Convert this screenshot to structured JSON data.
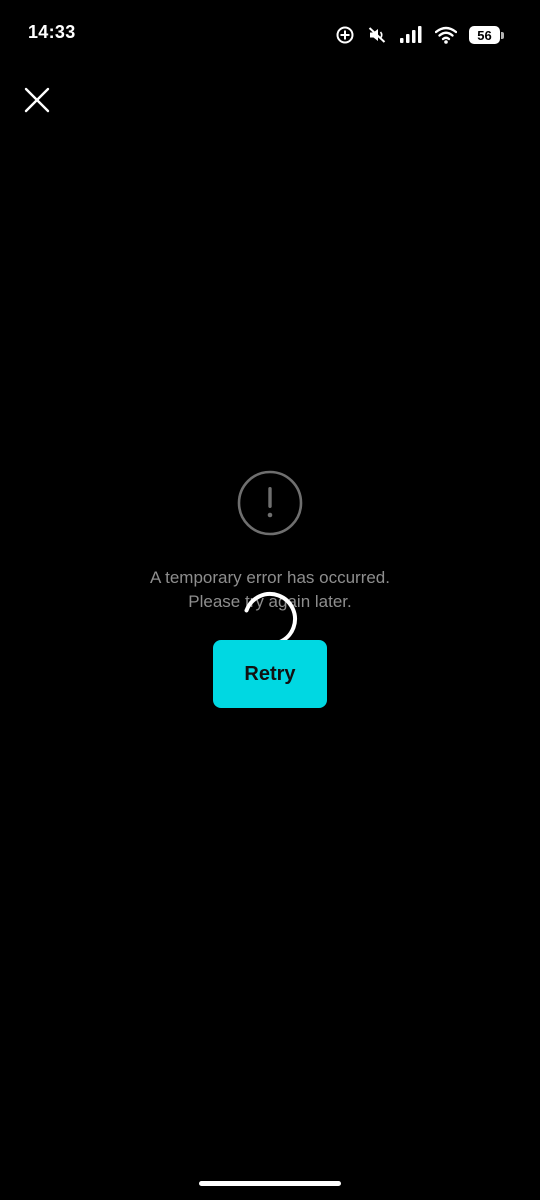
{
  "status_bar": {
    "time": "14:33",
    "battery_level": "56",
    "icons": [
      "sync-icon",
      "mute-icon",
      "signal-icon",
      "wifi-icon",
      "battery-icon"
    ]
  },
  "header": {
    "close_icon": "close-icon"
  },
  "error": {
    "icon": "exclamation-circle-icon",
    "line1": "A temporary error has occurred.",
    "line2": "Please try again later.",
    "retry_label": "Retry"
  },
  "colors": {
    "background": "#000000",
    "accent": "#00d8e2",
    "message_text": "#8e8e8e"
  }
}
